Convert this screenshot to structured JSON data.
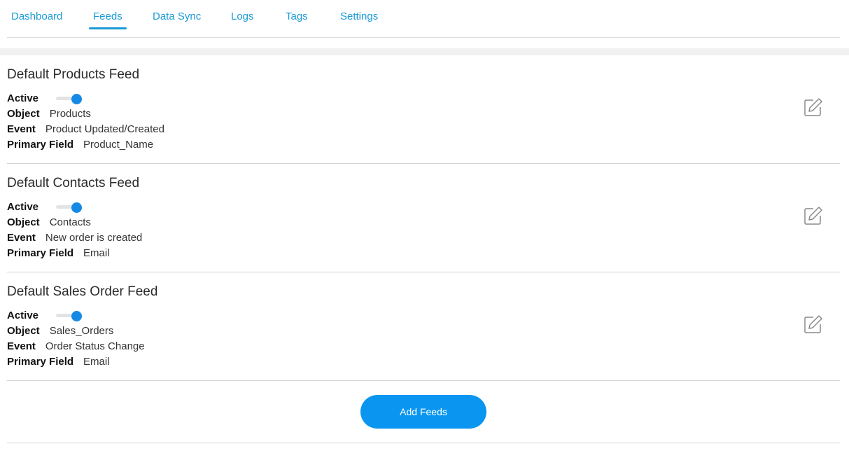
{
  "nav": {
    "tabs": [
      {
        "label": "Dashboard",
        "active": false
      },
      {
        "label": "Feeds",
        "active": true
      },
      {
        "label": "Data Sync",
        "active": false
      },
      {
        "label": "Logs",
        "active": false
      },
      {
        "label": "Tags",
        "active": false
      },
      {
        "label": "Settings",
        "active": false
      }
    ]
  },
  "labels": {
    "active": "Active",
    "object": "Object",
    "event": "Event",
    "primary_field": "Primary Field"
  },
  "feeds": [
    {
      "title": "Default Products Feed",
      "active": true,
      "object": "Products",
      "event": "Product Updated/Created",
      "primary_field": "Product_Name"
    },
    {
      "title": "Default Contacts Feed",
      "active": true,
      "object": "Contacts",
      "event": "New order is created",
      "primary_field": "Email"
    },
    {
      "title": "Default Sales Order Feed",
      "active": true,
      "object": "Sales_Orders",
      "event": "Order Status Change",
      "primary_field": "Email"
    }
  ],
  "actions": {
    "add_feeds_label": "Add Feeds"
  },
  "colors": {
    "accent": "#1a9ad6",
    "toggle_on": "#1589e6",
    "button": "#0a96f0"
  },
  "icons": {
    "edit": "edit-icon"
  }
}
